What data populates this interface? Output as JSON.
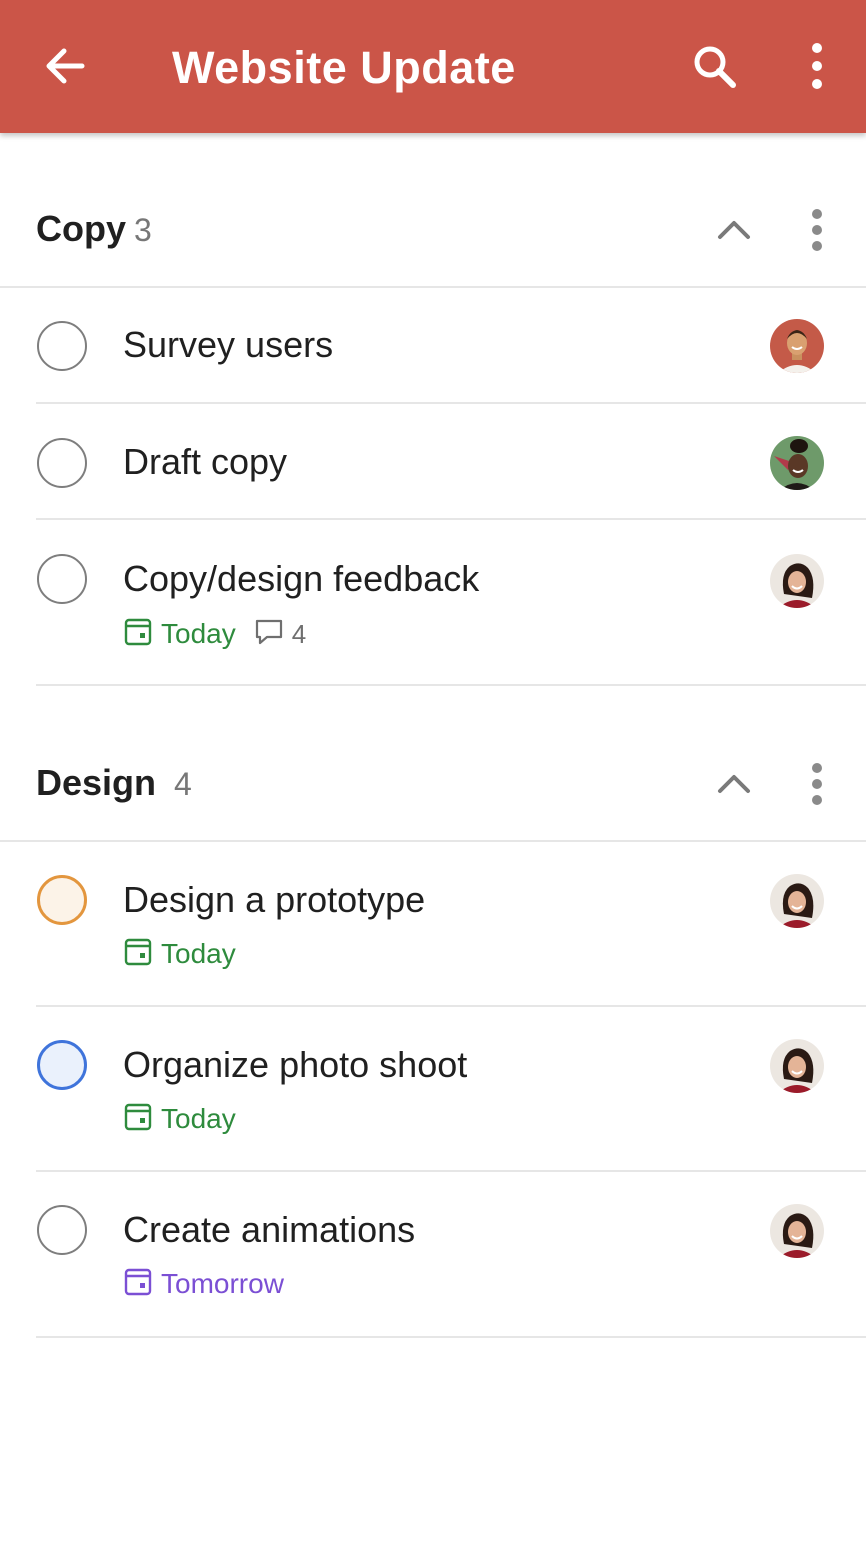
{
  "app_bar": {
    "title": "Website Update",
    "background": "#CB5548",
    "icons": [
      "back-arrow-icon",
      "search-icon",
      "more-vertical-icon"
    ]
  },
  "colors": {
    "priority_2": "#E3963E",
    "priority_3": "#3F74DB",
    "due_today": "#2E8B3D",
    "due_tomorrow": "#7B4FD4"
  },
  "sections": [
    {
      "name": "Copy",
      "count": "3",
      "tasks": [
        {
          "title": "Survey users",
          "priority": "none",
          "assignee": "avatar-red-shirt-man"
        },
        {
          "title": "Draft copy",
          "priority": "none",
          "assignee": "avatar-green-bg-woman"
        },
        {
          "title": "Copy/design feedback",
          "priority": "none",
          "due": "Today",
          "comments": "4",
          "assignee": "avatar-dark-hair-woman"
        }
      ]
    },
    {
      "name": "Design",
      "count": "4",
      "tasks": [
        {
          "title": "Design a prototype",
          "priority": "p2",
          "due": "Today",
          "assignee": "avatar-dark-hair-woman"
        },
        {
          "title": "Organize photo shoot",
          "priority": "p3",
          "due": "Today",
          "assignee": "avatar-dark-hair-woman"
        },
        {
          "title": "Create animations",
          "priority": "none",
          "due": "Tomorrow",
          "assignee": "avatar-dark-hair-woman"
        }
      ]
    }
  ]
}
